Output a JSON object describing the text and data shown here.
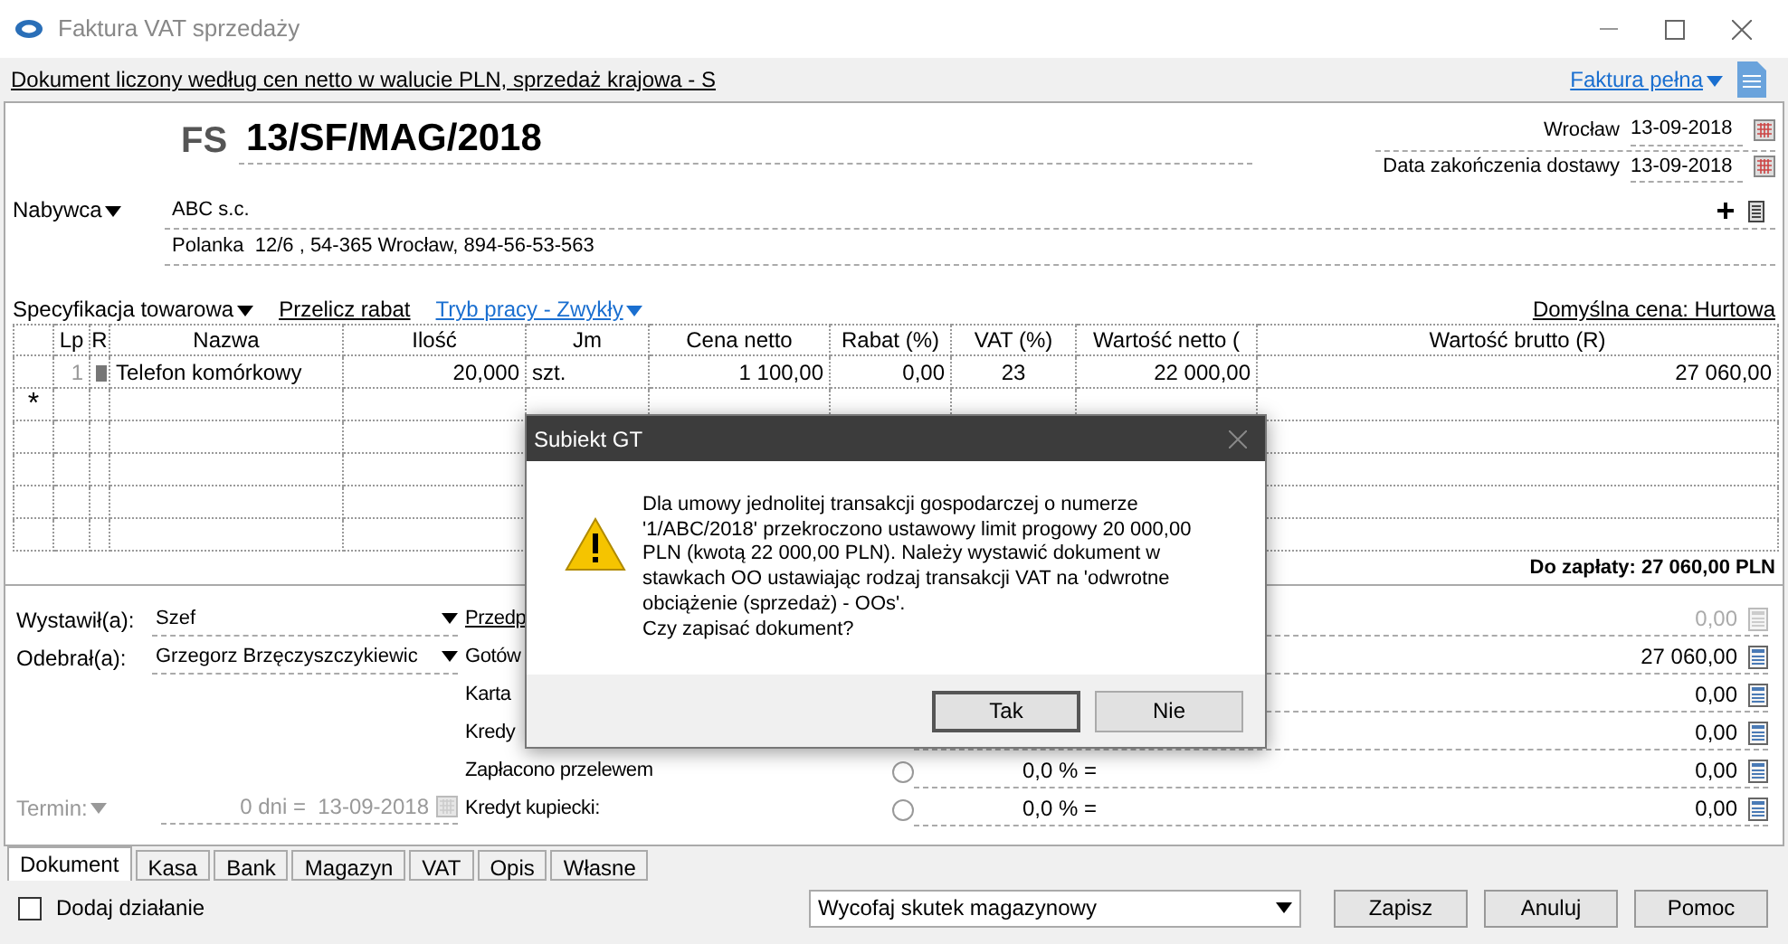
{
  "window": {
    "title": "Faktura VAT sprzedaży"
  },
  "info_bar": {
    "text": "Dokument liczony według cen netto w walucie PLN, sprzedaż krajowa - S",
    "invoice_type": "Faktura pełna"
  },
  "header": {
    "doc_type": "FS",
    "number": "13/SF/MAG/2018",
    "place": "Wrocław",
    "issue_date": "13-09-2018",
    "delivery_label": "Data zakończenia dostawy",
    "delivery_date": "13-09-2018"
  },
  "buyer": {
    "label": "Nabywca",
    "name": "ABC s.c.",
    "address": "Polanka  12/6 , 54-365 Wrocław, 894-56-53-563"
  },
  "toolbar": {
    "links": [
      {
        "label": "Specyfikacja towarowa",
        "kind": "menu"
      },
      {
        "label": "Przelicz rabat",
        "kind": "action"
      },
      {
        "label": "Tryb pracy - Zwykły",
        "kind": "mode"
      }
    ],
    "default_price": "Domyślna cena: Hurtowa"
  },
  "table": {
    "columns": [
      "Lp",
      "R",
      "Nazwa",
      "Ilość",
      "Jm",
      "Cena netto",
      "Rabat (%)",
      "VAT (%)",
      "Wartość netto (",
      "Wartość brutto (R)"
    ],
    "rows": [
      {
        "cells": [
          "1",
          "",
          "Telefon komórkowy",
          "20,000",
          "szt.",
          "1 100,00",
          "0,00",
          "23",
          "22 000,00",
          "27 060,00"
        ]
      }
    ],
    "new_row_marker": "*"
  },
  "total": "Do zapłaty: 27 060,00 PLN",
  "people": [
    {
      "label": "Wystawił(a):",
      "value": "Szef"
    },
    {
      "label": "Odebrał(a):",
      "value": "Grzegorz Brzęczyszczykiewic"
    }
  ],
  "term": {
    "label": "Termin:",
    "days": "0 dni =",
    "date": "13-09-2018",
    "disabled": true
  },
  "payments": [
    {
      "kind": "link",
      "label": "Przedp",
      "value": "0,00",
      "disabled": true
    },
    {
      "kind": "plain",
      "label": "Gotów",
      "value": "27 060,00",
      "disabled": false
    },
    {
      "kind": "plain",
      "label": "Karta",
      "value": "0,00",
      "disabled": false
    },
    {
      "kind": "plain",
      "label": "Kredy",
      "value": "0,00",
      "disabled": false
    },
    {
      "kind": "percent",
      "label": "Zapłacono przelewem",
      "percent": "0,0 % =",
      "value": "0,00",
      "disabled": false,
      "selected": false
    },
    {
      "kind": "percent",
      "label": "Kredyt kupiecki:",
      "percent": "0,0 % =",
      "value": "0,00",
      "disabled": false,
      "selected": false
    }
  ],
  "tabs": [
    {
      "label": "Dokument",
      "selected": true
    },
    {
      "label": "Kasa",
      "selected": false
    },
    {
      "label": "Bank",
      "selected": false
    },
    {
      "label": "Magazyn",
      "selected": false
    },
    {
      "label": "VAT",
      "selected": false
    },
    {
      "label": "Opis",
      "selected": false
    },
    {
      "label": "Własne",
      "selected": false
    }
  ],
  "footer": {
    "checkbox": {
      "label": "Dodaj działanie",
      "checked": false
    },
    "action_select": "Wycofaj skutek magazynowy",
    "buttons": [
      "Zapisz",
      "Anuluj",
      "Pomoc"
    ]
  },
  "dialog": {
    "title": "Subiekt GT",
    "message_lines": [
      "Dla umowy jednolitej transakcji gospodarczej o numerze",
      "'1/ABC/2018' przekroczono ustawowy limit progowy 20 000,00",
      "PLN (kwotą 22 000,00 PLN). Należy wystawić dokument w",
      "stawkach OO ustawiając rodzaj transakcji VAT na 'odwrotne",
      "obciążenie (sprzedaż) - OOs'.",
      "Czy zapisać dokument?"
    ],
    "buttons": [
      "Tak",
      "Nie"
    ]
  }
}
